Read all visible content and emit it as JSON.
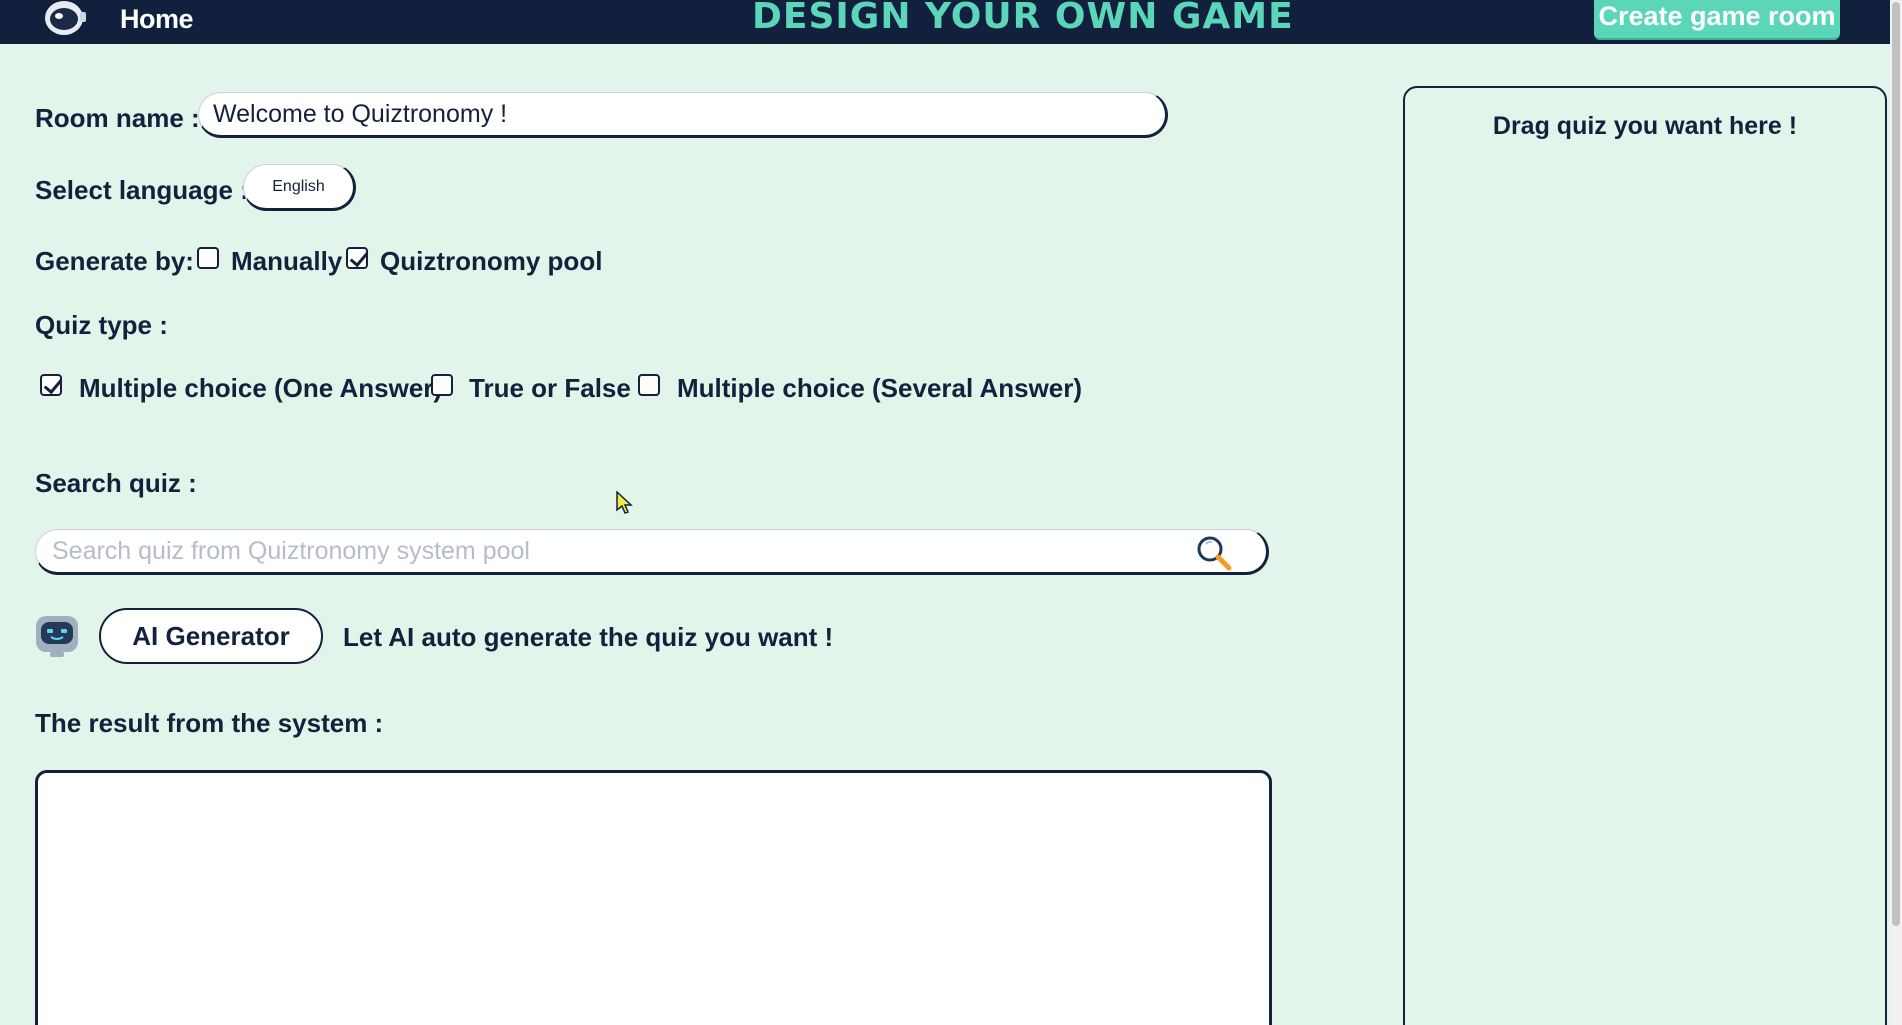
{
  "header": {
    "home_label": "Home",
    "title": "DESIGN YOUR OWN GAME",
    "create_button": "Create game room"
  },
  "form": {
    "room_name_label": "Room name :",
    "room_name_value": "Welcome to Quiztronomy !",
    "language_label": "Select language :",
    "language_value": "English",
    "generate_label": "Generate by:",
    "generate_options": [
      {
        "label": "Manually",
        "checked": false
      },
      {
        "label": "Quiztronomy pool",
        "checked": true
      }
    ],
    "quiz_type_label": "Quiz type :",
    "quiz_types": [
      {
        "label": "Multiple choice (One Answer)",
        "checked": true
      },
      {
        "label": "True or False",
        "checked": false
      },
      {
        "label": "Multiple choice (Several Answer)",
        "checked": false
      }
    ],
    "search_label": "Search quiz :",
    "search_placeholder": "Search quiz from Quiztronomy system pool",
    "ai_button": "AI Generator",
    "ai_text": "Let AI auto generate the quiz you want !",
    "result_label": "The result from the system :"
  },
  "drop_panel": {
    "title": "Drag quiz you want here !"
  },
  "colors": {
    "background": "#e3f5ea",
    "navy": "#10203d",
    "accent": "#5cd6b9"
  },
  "icons": [
    "astronaut-logo-icon",
    "search-icon",
    "robot-icon"
  ]
}
